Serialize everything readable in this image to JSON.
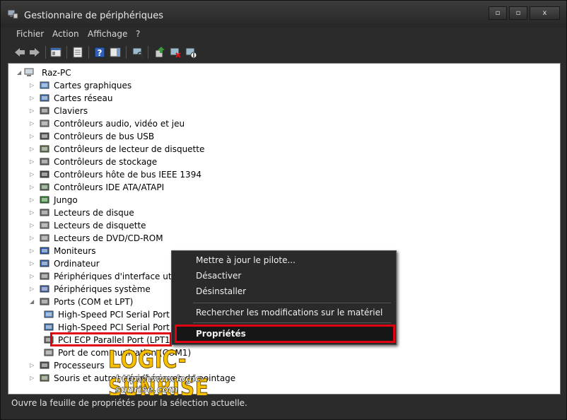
{
  "window": {
    "title": "Gestionnaire de périphériques",
    "minimize_glyph": "▫",
    "maximize_glyph": "▫",
    "close_glyph": "x"
  },
  "menu": [
    "Fichier",
    "Action",
    "Affichage",
    "?"
  ],
  "tree": {
    "root": "Raz-PC",
    "categories": [
      "Cartes graphiques",
      "Cartes réseau",
      "Claviers",
      "Contrôleurs audio, vidéo et jeu",
      "Contrôleurs de bus USB",
      "Contrôleurs de lecteur de disquette",
      "Contrôleurs de stockage",
      "Contrôleurs hôte de bus IEEE 1394",
      "Contrôleurs IDE ATA/ATAPI",
      "Jungo",
      "Lecteurs de disque",
      "Lecteurs de disquette",
      "Lecteurs de DVD/CD-ROM",
      "Moniteurs",
      "Ordinateur",
      "Périphériques d'interface utilisa",
      "Périphériques système",
      "Ports (COM et LPT)"
    ],
    "ports_children": [
      "High-Speed PCI Serial Port (",
      "High-Speed PCI Serial Port (",
      "PCI ECP Parallel Port (LPT1)",
      "Port de communication (COM1)"
    ],
    "after": [
      "Processeurs",
      "Souris et autres périphériques de pointage"
    ]
  },
  "context_menu": {
    "items": [
      "Mettre à jour le pilote...",
      "Désactiver",
      "Désinstaller",
      "Rechercher les modifications sur le matériel",
      "Propriétés"
    ]
  },
  "status": "Ouvre la feuille de propriétés pour la sélection actuelle.",
  "watermark": {
    "title": "LOGIC-SUNRISE",
    "url": "http://www.logic-sunrise.com"
  },
  "colors": {
    "highlight": "#e00010",
    "watermark": "#f5c000"
  }
}
